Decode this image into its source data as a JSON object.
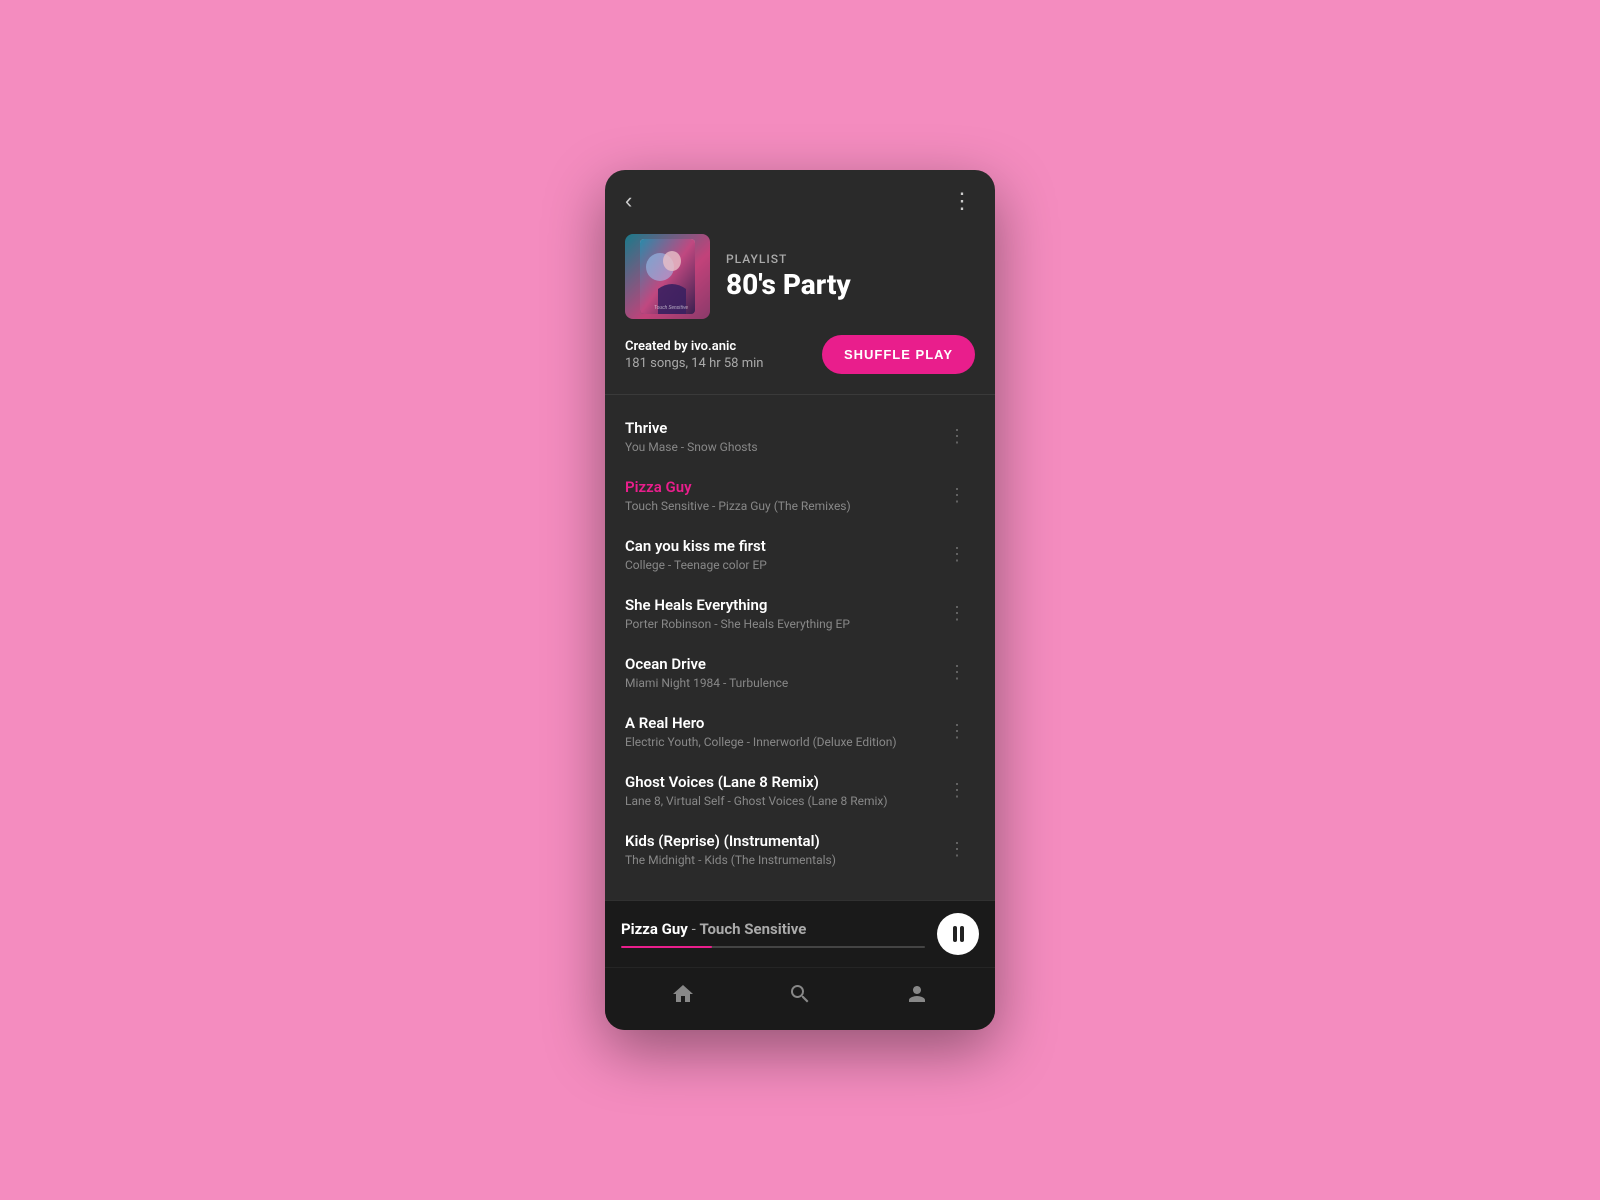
{
  "background": "#f48cbf",
  "phone": {
    "background": "#2a2a2a"
  },
  "header": {
    "back_label": "‹",
    "more_label": "⋮"
  },
  "playlist": {
    "label": "PLAYLIST",
    "title": "80's Party",
    "creator_prefix": "Created by",
    "creator": "ivo.anic",
    "meta": "181 songs, 14 hr 58 min",
    "shuffle_label": "SHUFFLE PLAY"
  },
  "tracks": [
    {
      "name": "Thrive",
      "sub": "You Mase - Snow Ghosts",
      "active": false
    },
    {
      "name": "Pizza Guy",
      "sub": "Touch Sensitive - Pizza Guy (The Remixes)",
      "active": true
    },
    {
      "name": "Can you kiss me first",
      "sub": "College - Teenage color EP",
      "active": false
    },
    {
      "name": "She Heals Everything",
      "sub": "Porter Robinson - She Heals Everything EP",
      "active": false
    },
    {
      "name": "Ocean Drive",
      "sub": "Miami Night 1984 - Turbulence",
      "active": false
    },
    {
      "name": "A Real Hero",
      "sub": "Electric Youth, College - Innerworld (Deluxe Edition)",
      "active": false
    },
    {
      "name": "Ghost Voices (Lane 8 Remix)",
      "sub": "Lane 8, Virtual Self - Ghost Voices (Lane 8 Remix)",
      "active": false
    },
    {
      "name": "Kids (Reprise) (Instrumental)",
      "sub": "The Midnight - Kids (The Instrumentals)",
      "active": false
    }
  ],
  "now_playing": {
    "track": "Pizza Guy",
    "separator": " - ",
    "artist": "Touch Sensitive",
    "progress": 30
  },
  "bottom_nav": [
    {
      "id": "home",
      "label": "home",
      "icon": "home"
    },
    {
      "id": "search",
      "label": "search",
      "icon": "search"
    },
    {
      "id": "profile",
      "label": "profile",
      "icon": "user"
    }
  ]
}
